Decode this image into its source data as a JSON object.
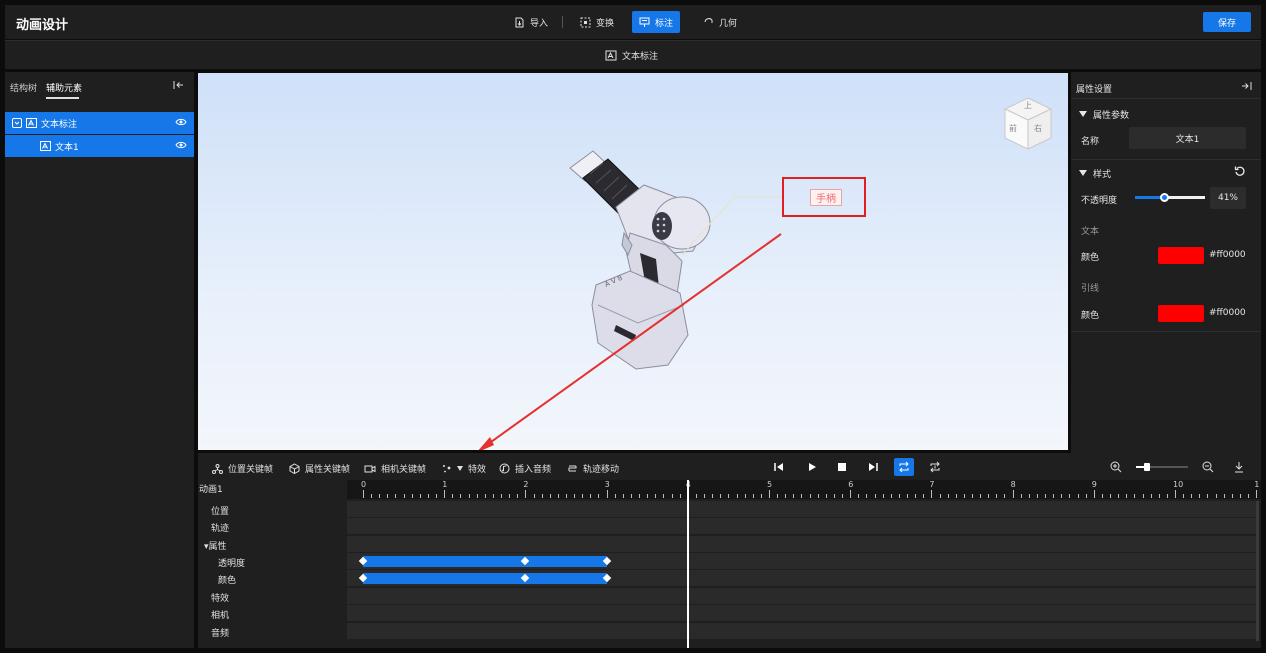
{
  "app": {
    "title": "动画设计",
    "save_label": "保存"
  },
  "toolbar": {
    "items": [
      {
        "label": "导入",
        "icon": "import-icon"
      },
      {
        "label": "变换",
        "icon": "transform-icon"
      },
      {
        "label": "标注",
        "icon": "annotate-icon",
        "active": true
      },
      {
        "label": "几何",
        "icon": "geometry-icon"
      }
    ]
  },
  "subbar": {
    "label": "文本标注"
  },
  "left_panel": {
    "tabs": [
      "结构树",
      "辅助元素"
    ],
    "active_tab": "辅助元素",
    "tree": [
      {
        "label": "文本标注",
        "level": 0
      },
      {
        "label": "文本1",
        "level": 1
      }
    ]
  },
  "viewport": {
    "annotation_text": "手柄",
    "viewcube": {
      "top": "上",
      "front": "前",
      "right": "右"
    },
    "colors": {
      "highlight": "#e02020",
      "arrow": "#e53030"
    }
  },
  "right_panel": {
    "title": "属性设置",
    "section_params": "属性参数",
    "name_label": "名称",
    "name_value": "文本1",
    "section_style": "样式",
    "opacity_label": "不透明度",
    "opacity_value": "41%",
    "opacity_fraction": 0.41,
    "text_group": "文本",
    "text_color_label": "颜色",
    "text_color_value": "#ff0000",
    "line_group": "引线",
    "line_color_label": "颜色",
    "line_color_value": "#ff0000"
  },
  "timeline": {
    "tools": [
      "位置关键帧",
      "属性关键帧",
      "相机关键帧",
      "特效",
      "插入音频",
      "轨迹移动"
    ],
    "animation_name": "动画1",
    "tracks": [
      "位置",
      "轨迹",
      "▾属性",
      "透明度",
      "颜色",
      "特效",
      "相机",
      "音频"
    ],
    "ticks": [
      "0",
      "1",
      "2",
      "3",
      "4",
      "5",
      "6",
      "7",
      "8",
      "9",
      "10",
      "1"
    ],
    "playhead_time": 4,
    "keyframes": {
      "opacity": [
        0,
        2,
        3
      ],
      "color": [
        0,
        2,
        3
      ]
    }
  }
}
